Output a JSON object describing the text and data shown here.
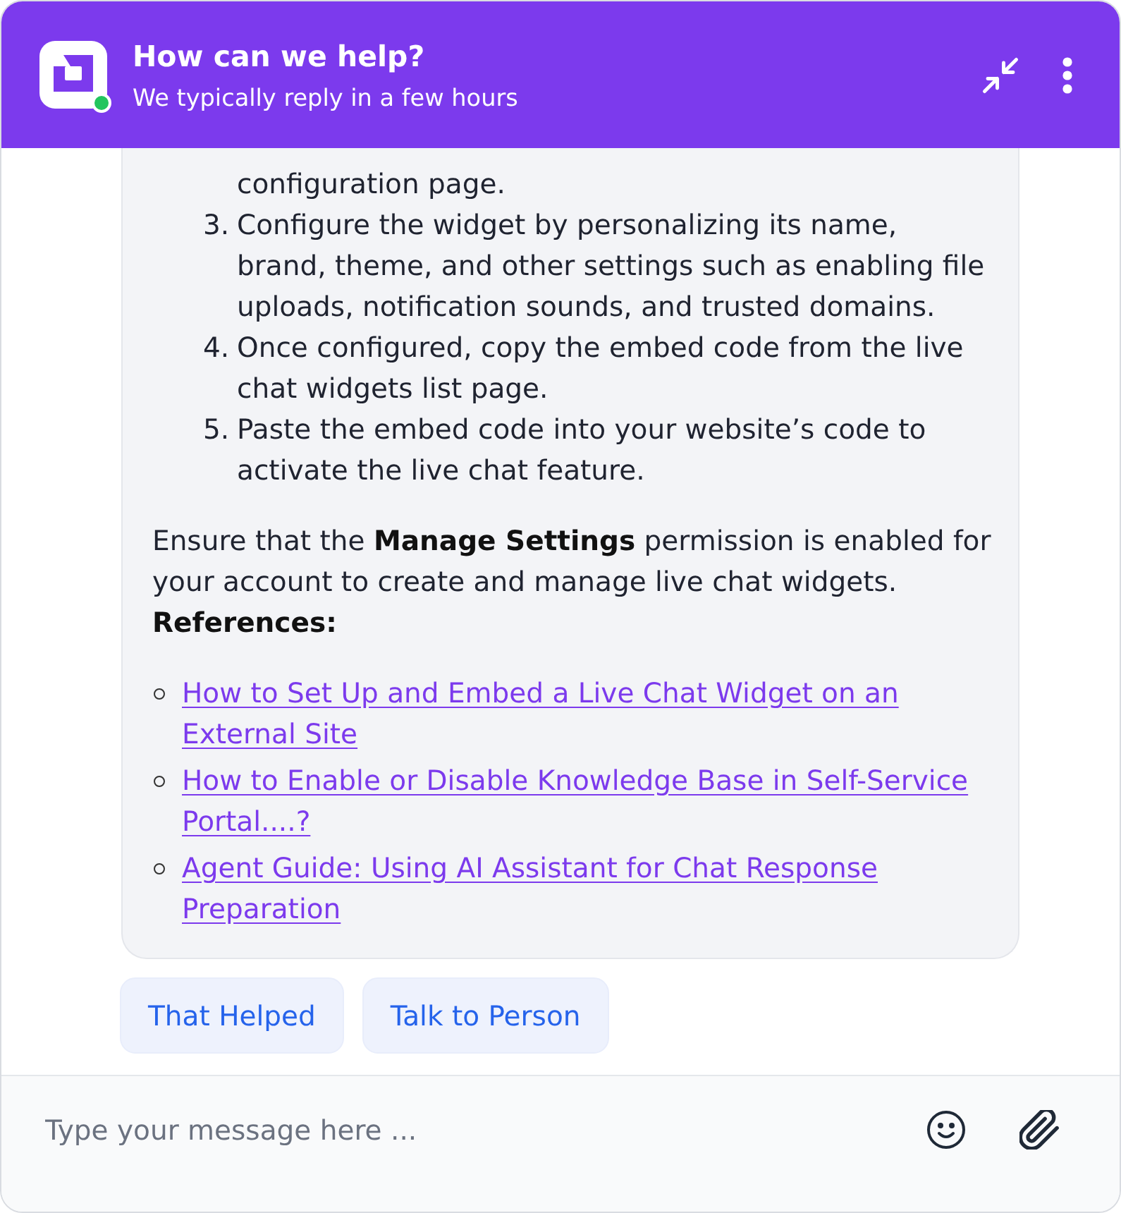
{
  "header": {
    "title": "How can we help?",
    "subtitle": "We typically reply in a few hours",
    "online": true
  },
  "message": {
    "steps": [
      {
        "text": "configuration page."
      },
      {
        "marker": "3.",
        "text": "Configure the widget by personalizing its name, brand, theme, and other settings such as enabling file uploads, notification sounds, and trusted domains."
      },
      {
        "marker": "4.",
        "text": "Once configured, copy the embed code from the live chat widgets list page."
      },
      {
        "marker": "5.",
        "text": "Paste the embed code into your website’s code to activate the live chat feature."
      }
    ],
    "note": "Ensure that the **Manage Settings** permission is enabled for your account to create and manage live chat widgets.",
    "references_heading": "References:",
    "references": [
      "How to Set Up and Embed a Live Chat Widget on an External Site",
      "How to Enable or Disable Knowledge Base in Self-Service Portal....?",
      "Agent Guide: Using AI Assistant for Chat Response Preparation"
    ]
  },
  "quick_replies": [
    "That Helped",
    "Talk to Person"
  ],
  "composer": {
    "placeholder": "Type your message here ..."
  }
}
